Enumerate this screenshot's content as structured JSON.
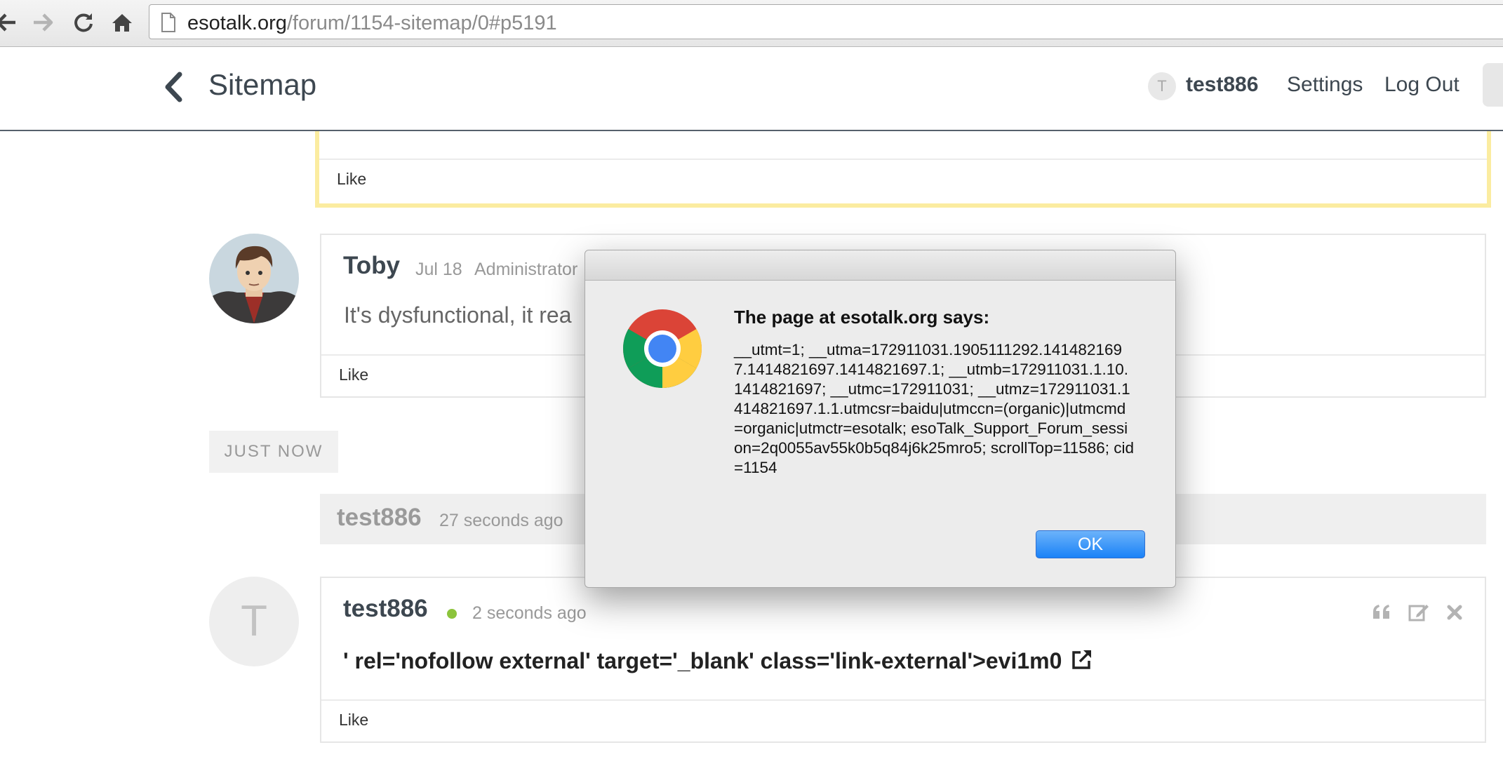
{
  "browser": {
    "url_host": "esotalk.org",
    "url_path": "/forum/1154-sitemap/0#p5191"
  },
  "header": {
    "title": "Sitemap",
    "avatar_initial": "T",
    "username": "test886",
    "settings_label": "Settings",
    "logout_label": "Log Out"
  },
  "posts": {
    "highlighted": {
      "like_label": "Like"
    },
    "toby": {
      "author": "Toby",
      "date": "Jul 18",
      "role": "Administrator",
      "body": "It's dysfunctional, it rea",
      "like_label": "Like"
    },
    "separator": {
      "label": "JUST NOW"
    },
    "activity": {
      "user": "test886",
      "time": "27 seconds ago"
    },
    "test886": {
      "avatar_initial": "T",
      "author": "test886",
      "time": "2 seconds ago",
      "body": "' rel='nofollow external' target='_blank' class='link-external'>evi1m0",
      "like_label": "Like"
    }
  },
  "dialog": {
    "title": "The page at esotalk.org says:",
    "message": "__utmt=1; __utma=172911031.1905111292.1414821697.1414821697.1414821697.1; __utmb=172911031.1.10.1414821697; __utmc=172911031; __utmz=172911031.1414821697.1.1.utmcsr=baidu|utmccn=(organic)|utmcmd=organic|utmctr=esotalk; esoTalk_Support_Forum_session=2q0055av55k0b5q84j6k25mro5; scrollTop=11586; cid=1154",
    "ok_label": "OK"
  },
  "colors": {
    "accent_blue": "#1a82f7",
    "highlight_border": "#fbeca0",
    "online": "#8cc43c"
  }
}
